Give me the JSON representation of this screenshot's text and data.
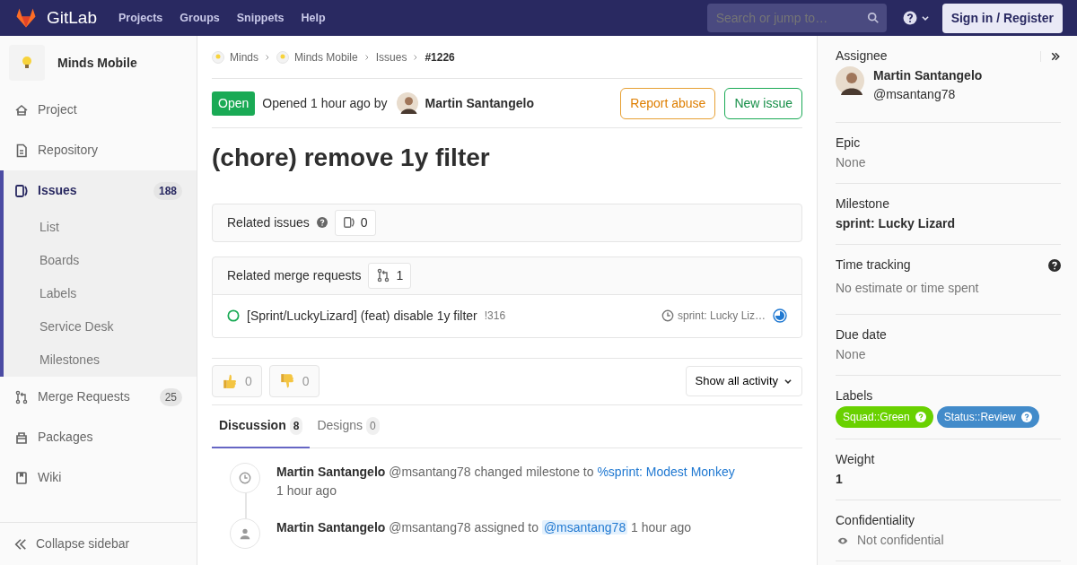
{
  "navbar": {
    "brand": "GitLab",
    "links": [
      "Projects",
      "Groups",
      "Snippets",
      "Help"
    ],
    "search": {
      "placeholder": "Search or jump to…"
    },
    "sign_in": "Sign in / Register"
  },
  "sidebar": {
    "project": "Minds Mobile",
    "items": [
      {
        "label": "Project",
        "kind": "home",
        "selected": false
      },
      {
        "label": "Repository",
        "kind": "doc",
        "selected": false
      },
      {
        "label": "Issues",
        "kind": "issues",
        "count": "188",
        "selected": true,
        "children": [
          {
            "label": "List"
          },
          {
            "label": "Boards"
          },
          {
            "label": "Labels"
          },
          {
            "label": "Service Desk"
          },
          {
            "label": "Milestones"
          }
        ]
      },
      {
        "label": "Merge Requests",
        "kind": "merge",
        "count": "25",
        "selected": false
      },
      {
        "label": "Packages",
        "kind": "package",
        "selected": false
      },
      {
        "label": "Wiki",
        "kind": "book",
        "selected": false
      }
    ],
    "collapse": "Collapse sidebar"
  },
  "breadcrumbs": [
    {
      "label": "Minds",
      "avatar": true
    },
    {
      "label": "Minds Mobile",
      "avatar": true
    },
    {
      "label": "Issues",
      "avatar": false
    },
    {
      "label": "#1226",
      "avatar": false
    }
  ],
  "issue": {
    "status": "Open",
    "opened": "Opened 1 hour ago by",
    "author": "Martin Santangelo",
    "buttons": [
      {
        "label": "Report abuse",
        "kind": "warning"
      },
      {
        "label": "New issue",
        "kind": "success"
      }
    ],
    "title": "(chore) remove 1y filter"
  },
  "related_issues": {
    "title": "Related issues",
    "count": "0"
  },
  "related_merge_requests": {
    "title": "Related merge requests",
    "count": "1",
    "items": [
      {
        "title": "[Sprint/LuckyLizard] (feat) disable 1y filter",
        "ref": "!316",
        "milestone": "sprint: Lucky Liz…"
      }
    ]
  },
  "awards": [
    {
      "kind": "thumbsup",
      "count": "0"
    },
    {
      "kind": "thumbsdown",
      "count": "0"
    }
  ],
  "activity_filter": "Show all activity",
  "tabs": [
    {
      "label": "Discussion",
      "count": "8",
      "selected": true
    },
    {
      "label": "Designs",
      "count": "0",
      "selected": false
    }
  ],
  "notes": [
    {
      "kind": "milestone",
      "author": "Martin Santangelo",
      "username": "@msantang78",
      "action": "changed milestone to",
      "link": "%sprint: Modest Monkey",
      "time": "1 hour ago"
    },
    {
      "kind": "assignee",
      "author": "Martin Santangelo",
      "username": "@msantang78",
      "action": "assigned to",
      "link": "@msantang78",
      "time": "1 hour ago"
    }
  ],
  "right_sidebar": {
    "assignee": {
      "label": "Assignee",
      "name": "Martin Santangelo",
      "username": "@msantang78"
    },
    "blocks": [
      {
        "label": "Epic",
        "value": "None",
        "kind": "muted",
        "help": false
      },
      {
        "label": "Milestone",
        "value": "sprint: Lucky Lizard",
        "kind": "bold",
        "help": false
      },
      {
        "label": "Time tracking",
        "value": "No estimate or time spent",
        "kind": "muted",
        "help": true
      },
      {
        "label": "Due date",
        "value": "None",
        "kind": "muted",
        "help": false
      }
    ],
    "labels": {
      "label": "Labels",
      "items": [
        {
          "text": "Squad::Green",
          "color": "#69d100"
        },
        {
          "text": "Status::Review",
          "color": "#428bca"
        }
      ]
    },
    "weight": {
      "label": "Weight",
      "value": "1"
    },
    "confidentiality": {
      "label": "Confidentiality",
      "value": "Not confidential"
    }
  }
}
